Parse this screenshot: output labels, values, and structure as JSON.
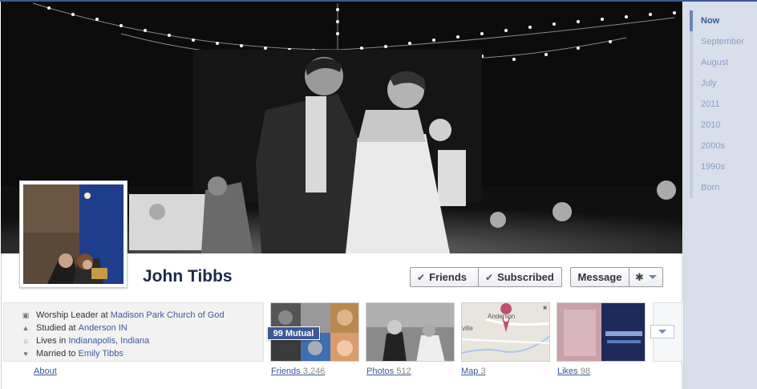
{
  "profile": {
    "name": "John Tibbs"
  },
  "actions": {
    "friends_label": "Friends",
    "subscribed_label": "Subscribed",
    "message_label": "Message"
  },
  "info": {
    "work_prefix": "Worship Leader at",
    "work_place": "Madison Park Church of God",
    "study_prefix": "Studied at",
    "study_place": "Anderson IN",
    "lives_prefix": "Lives in",
    "lives_place": "Indianapolis, Indiana",
    "married_prefix": "Married to",
    "married_person": "Emily Tibbs"
  },
  "about_label": "About",
  "apps": {
    "friends": {
      "label": "Friends",
      "count": "3,246",
      "mutual": "99 Mutual"
    },
    "photos": {
      "label": "Photos",
      "count": "512"
    },
    "map": {
      "label": "Map",
      "count": "3",
      "place_fragment": "Anderson",
      "place_fragment2": "ville"
    },
    "likes": {
      "label": "Likes",
      "count": "98"
    }
  },
  "timeline": {
    "items": [
      "Now",
      "September",
      "August",
      "July",
      "2011",
      "2010",
      "2000s",
      "1990s",
      "Born"
    ]
  },
  "colors": {
    "brand": "#3b5998",
    "nav_bg": "#d8dfea"
  },
  "icons": [
    "briefcase-icon",
    "graduation-icon",
    "house-icon",
    "heart-icon",
    "check-icon",
    "gear-icon",
    "chevron-down-icon",
    "map-pin-icon"
  ]
}
